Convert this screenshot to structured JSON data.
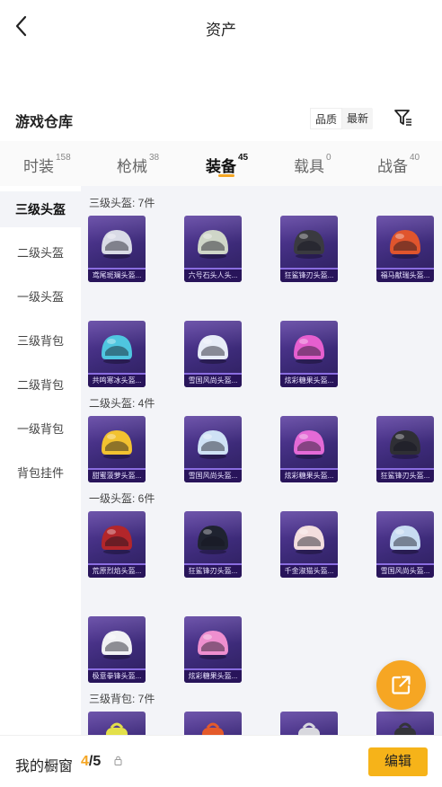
{
  "header": {
    "title": "资产"
  },
  "warehouse": {
    "title": "游戏仓库",
    "sort": {
      "quality": "品质",
      "newest": "最新"
    }
  },
  "tabs": [
    {
      "label": "时装",
      "count": "158"
    },
    {
      "label": "枪械",
      "count": "38"
    },
    {
      "label": "装备",
      "count": "45"
    },
    {
      "label": "载具",
      "count": "0"
    },
    {
      "label": "战备",
      "count": "40"
    }
  ],
  "sidebar": {
    "items": [
      {
        "label": "三级头盔"
      },
      {
        "label": "二级头盔"
      },
      {
        "label": "一级头盔"
      },
      {
        "label": "三级背包"
      },
      {
        "label": "二级背包"
      },
      {
        "label": "一级背包"
      },
      {
        "label": "背包挂件"
      }
    ]
  },
  "groups": [
    {
      "label": "三级头盔: 7件",
      "items": [
        {
          "name": "鸢尾斑斓头盔...",
          "color": "#d9dbe6"
        },
        {
          "name": "六号石头人头...",
          "color": "#cfd6c8"
        },
        {
          "name": "狂鲨锋刃头盔...",
          "color": "#3a3a40"
        },
        {
          "name": "福马献瑞头盔...",
          "color": "#e0552d"
        },
        {
          "name": "共鸣寒冰头盔...",
          "color": "#4fc6e0"
        },
        {
          "name": "雪国风尚头盔...",
          "color": "#e7ecf7"
        },
        {
          "name": "炫彩糖果头盔...",
          "color": "#e65fcf"
        }
      ]
    },
    {
      "label": "二级头盔: 4件",
      "items": [
        {
          "name": "甜蜜菠萝头盔...",
          "color": "#f2c230"
        },
        {
          "name": "雪国风尚头盔...",
          "color": "#cfe2f5"
        },
        {
          "name": "炫彩糖果头盔...",
          "color": "#e46ad6"
        },
        {
          "name": "狂鲨锋刃头盔...",
          "color": "#2f2f35"
        }
      ]
    },
    {
      "label": "一级头盔: 6件",
      "items": [
        {
          "name": "荒原烈焰头盔...",
          "color": "#b3262a"
        },
        {
          "name": "狂鲨锋刃头盔...",
          "color": "#1f2330"
        },
        {
          "name": "千金淑猫头盔...",
          "color": "#f3dede"
        },
        {
          "name": "雪国风尚头盔...",
          "color": "#c8dcf2"
        },
        {
          "name": "极意拳锋头盔...",
          "color": "#f1f1f4"
        },
        {
          "name": "炫彩糖果头盔...",
          "color": "#ee8fcf"
        }
      ]
    },
    {
      "label": "三级背包: 7件",
      "items": [
        {
          "name": "",
          "color": "#e3e04a"
        },
        {
          "name": "",
          "color": "#e45a2a"
        },
        {
          "name": "",
          "color": "#d8d8de"
        },
        {
          "name": "",
          "color": "#34343a"
        }
      ]
    }
  ],
  "showcase": {
    "label": "我的橱窗",
    "current": "4",
    "total": "/5"
  },
  "actions": {
    "edit_label": "编辑"
  },
  "colors": {
    "accent": "#f5a623",
    "card_bg": "#3c2a78",
    "content_bg": "#f3f4f8"
  },
  "icons": {
    "back": "chevron-left-icon",
    "filter": "filter-icon",
    "share": "external-link-icon",
    "lock": "lock-icon"
  }
}
